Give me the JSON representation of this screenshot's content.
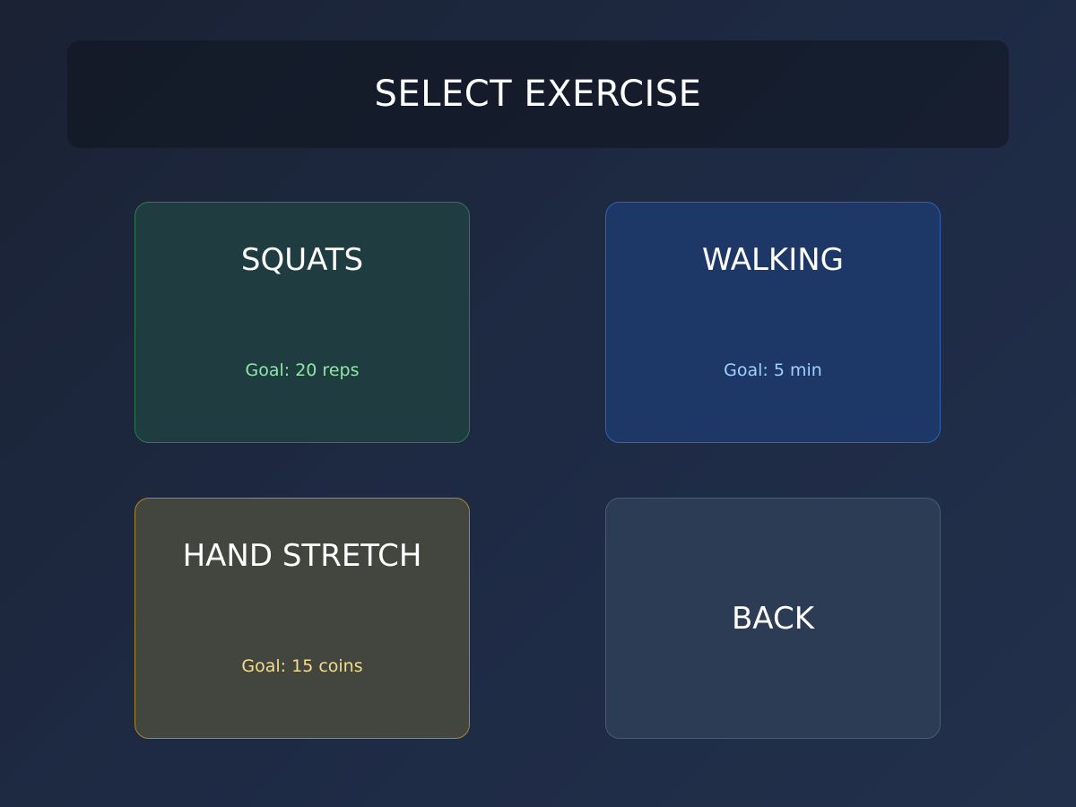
{
  "header": {
    "title": "SELECT EXERCISE"
  },
  "exercises": [
    {
      "name": "SQUATS",
      "goal": "Goal: 20 reps",
      "accent": "#2e7a4e",
      "goal_color": "#8fe6a6"
    },
    {
      "name": "WALKING",
      "goal": "Goal: 5 min",
      "accent": "#2e63b8",
      "goal_color": "#9fd0ff"
    },
    {
      "name": "HAND STRETCH",
      "goal": "Goal: 15 coins",
      "accent": "#a5882c",
      "goal_color": "#f5dc88"
    }
  ],
  "back": {
    "label": "BACK"
  }
}
